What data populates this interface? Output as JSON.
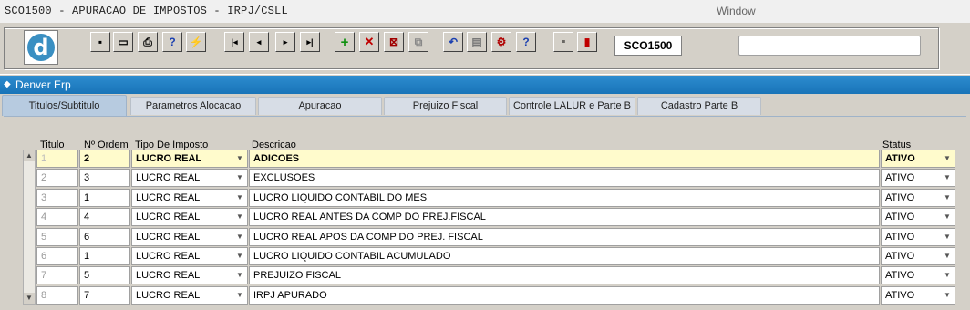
{
  "window": {
    "title": "SCO1500 - APURACAO DE IMPOSTOS - IRPJ/CSLL",
    "label": "Window"
  },
  "toolbar": {
    "form_code": "SCO1500",
    "search_value": ""
  },
  "app": {
    "name": "Denver Erp"
  },
  "tabs": [
    {
      "label": "Titulos/Subtitulo"
    },
    {
      "label": "Parametros Alocacao"
    },
    {
      "label": "Apuracao"
    },
    {
      "label": "Prejuizo Fiscal"
    },
    {
      "label": "Controle LALUR e Parte B"
    },
    {
      "label": "Cadastro Parte B"
    }
  ],
  "grid": {
    "headers": {
      "titulo": "Titulo",
      "ordem": "Nº Ordem",
      "tipo": "Tipo De Imposto",
      "descricao": "Descricao",
      "status": "Status"
    },
    "rows": [
      {
        "titulo": "1",
        "ordem": "2",
        "tipo": "LUCRO REAL",
        "descricao": "ADICOES",
        "status": "ATIVO"
      },
      {
        "titulo": "2",
        "ordem": "3",
        "tipo": "LUCRO REAL",
        "descricao": "EXCLUSOES",
        "status": "ATIVO"
      },
      {
        "titulo": "3",
        "ordem": "1",
        "tipo": "LUCRO REAL",
        "descricao": "LUCRO LIQUIDO CONTABIL DO MES",
        "status": "ATIVO"
      },
      {
        "titulo": "4",
        "ordem": "4",
        "tipo": "LUCRO REAL",
        "descricao": "LUCRO REAL ANTES DA COMP DO PREJ.FISCAL",
        "status": "ATIVO"
      },
      {
        "titulo": "5",
        "ordem": "6",
        "tipo": "LUCRO REAL",
        "descricao": "LUCRO REAL APOS DA COMP DO PREJ. FISCAL",
        "status": "ATIVO"
      },
      {
        "titulo": "6",
        "ordem": "1",
        "tipo": "LUCRO REAL",
        "descricao": "LUCRO LIQUIDO CONTABIL ACUMULADO",
        "status": "ATIVO"
      },
      {
        "titulo": "7",
        "ordem": "5",
        "tipo": "LUCRO REAL",
        "descricao": "PREJUIZO FISCAL",
        "status": "ATIVO"
      },
      {
        "titulo": "8",
        "ordem": "7",
        "tipo": "LUCRO REAL",
        "descricao": "IRPJ APURADO",
        "status": "ATIVO"
      }
    ]
  }
}
